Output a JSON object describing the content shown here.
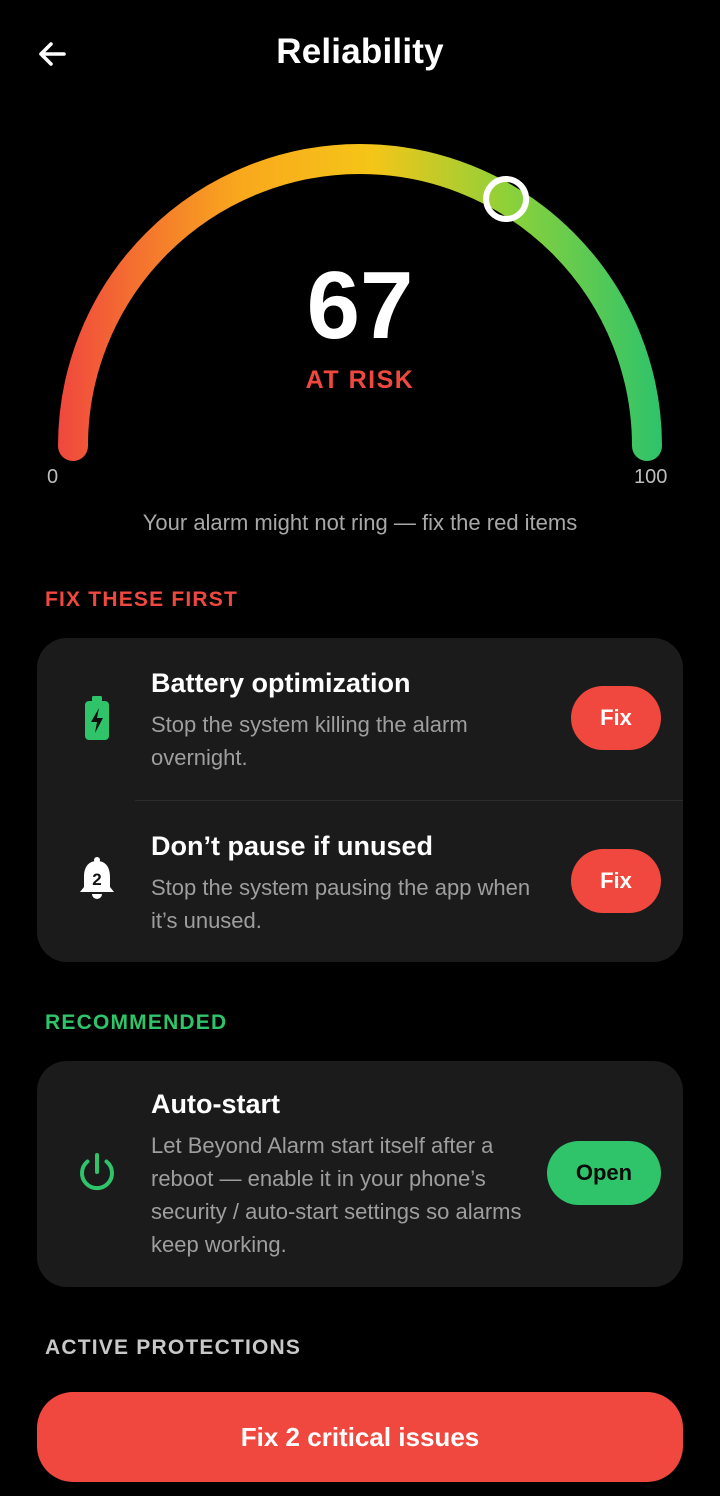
{
  "header": {
    "title": "Reliability",
    "back_icon": "arrow-left-icon"
  },
  "gauge": {
    "score": "67",
    "value": 67,
    "min_label": "0",
    "max_label": "100",
    "status": "AT RISK",
    "status_color": "#f0483e",
    "caption": "Your alarm might not ring — fix the red items",
    "gradient_colors": [
      "#f0483e",
      "#f9a81c",
      "#f5c518",
      "#8cd13a",
      "#2fc36a"
    ]
  },
  "sections": {
    "critical": {
      "label": "FIX THESE FIRST",
      "color": "#f0483e",
      "items": [
        {
          "icon": "battery-charging-icon",
          "title": "Battery optimization",
          "description": "Stop the system killing the alarm overnight.",
          "action": "Fix"
        },
        {
          "icon": "bell-badge-icon",
          "title": "Don’t pause if unused",
          "description": "Stop the system pausing the app when it’s unused.",
          "action": "Fix"
        }
      ]
    },
    "recommended": {
      "label": "RECOMMENDED",
      "color": "#2fc36a",
      "items": [
        {
          "icon": "power-icon",
          "title": "Auto-start",
          "description": "Let Beyond Alarm start itself after a reboot — enable it in your phone’s security / auto-start settings so alarms keep working.",
          "action": "Open"
        }
      ]
    },
    "active": {
      "label": "ACTIVE PROTECTIONS",
      "color": "#c8c8c8"
    }
  },
  "cta": {
    "label": "Fix 2 critical issues",
    "color": "#f0483e"
  }
}
